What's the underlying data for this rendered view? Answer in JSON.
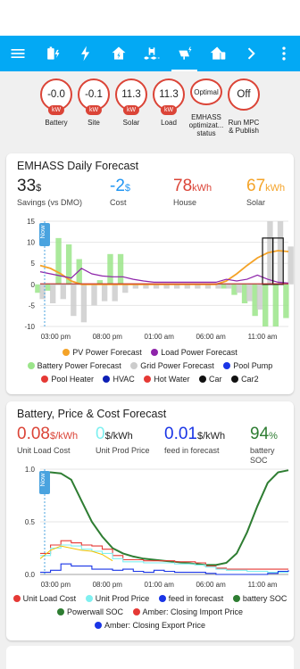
{
  "toolbar": {
    "tabs": [
      "menu-icon",
      "battery-charging-icon",
      "flash-icon",
      "home-lightning-icon",
      "pool-icon",
      "solar-power-icon",
      "home-battery-icon",
      "chevron-right-icon",
      "more-vert-icon"
    ]
  },
  "badges": [
    {
      "value": "-0.0",
      "unit": "kW",
      "label": "Battery"
    },
    {
      "value": "-0.1",
      "unit": "kW",
      "label": "Site"
    },
    {
      "value": "11.3",
      "unit": "kW",
      "label": "Solar"
    },
    {
      "value": "11.3",
      "unit": "kW",
      "label": "Load"
    },
    {
      "value": "Optimal",
      "unit": "",
      "label": "EMHASS optimizat... status"
    },
    {
      "value": "Off",
      "unit": "",
      "label": "Run MPC & Publish"
    }
  ],
  "forecast_card": {
    "title": "EMHASS Daily Forecast",
    "stats": [
      {
        "value": "33",
        "unit": "$",
        "name": "Savings (vs DMO)",
        "color": "#212121"
      },
      {
        "value": "-2",
        "unit": "$",
        "name": "Cost",
        "color": "#2196f3"
      },
      {
        "value": "78",
        "unit": "kWh",
        "name": "House",
        "color": "#db4437"
      },
      {
        "value": "67",
        "unit": "kWh",
        "name": "Solar",
        "color": "#f4a328"
      }
    ],
    "now_label": "Now",
    "legend": [
      {
        "label": "PV Power Forecast",
        "color": "#f4a328"
      },
      {
        "label": "Load Power Forecast",
        "color": "#8e24aa"
      },
      {
        "label": "Battery Power Forecast",
        "color": "#9be58a"
      },
      {
        "label": "Grid Power Forecast",
        "color": "#cccccc"
      },
      {
        "label": "Pool Pump",
        "color": "#1a35e6"
      },
      {
        "label": "Pool Heater",
        "color": "#e53935"
      },
      {
        "label": "HVAC",
        "color": "#0d1fb5"
      },
      {
        "label": "Hot Water",
        "color": "#e53935"
      },
      {
        "label": "Car",
        "color": "#111111"
      },
      {
        "label": "Car2",
        "color": "#111111"
      }
    ]
  },
  "price_card": {
    "title": "Battery, Price & Cost Forecast",
    "stats": [
      {
        "value": "0.08",
        "unit": "$/kWh",
        "name": "Unit Load Cost",
        "color": "#db4437"
      },
      {
        "value": "0",
        "unit": "$/kWh",
        "name": "Unit Prod Price",
        "color": "#7ff0f0"
      },
      {
        "value": "0.01",
        "unit": "$/kWh",
        "name": "feed in forecast",
        "color": "#1a35e6"
      },
      {
        "value": "94",
        "unit": "%",
        "name": "battery SOC",
        "color": "#2e7d32"
      }
    ],
    "now_label": "Now",
    "legend": [
      {
        "label": "Unit Load Cost",
        "color": "#e53935"
      },
      {
        "label": "Unit Prod Price",
        "color": "#7ff0f0"
      },
      {
        "label": "feed in forecast",
        "color": "#1a35e6"
      },
      {
        "label": "battery SOC",
        "color": "#2e7d32"
      },
      {
        "label": "Powerwall SOC",
        "color": "#2e7d32"
      },
      {
        "label": "Amber: Closing Import Price",
        "color": "#e53935"
      },
      {
        "label": "Amber: Closing Export Price",
        "color": "#1a35e6"
      }
    ]
  },
  "chart_data": [
    {
      "type": "area",
      "ylim": [
        -10,
        15
      ],
      "yticks": [
        "15",
        "10",
        "5",
        "0",
        "-5",
        "-10"
      ],
      "xticks": [
        "03:00 pm",
        "08:00 pm",
        "01:00 am",
        "06:00 am",
        "11:00 am"
      ],
      "series": [
        {
          "name": "PV Power Forecast",
          "x": [
            0,
            1,
            2,
            3,
            4,
            5,
            6,
            7,
            8,
            9,
            10,
            11,
            12,
            13,
            14,
            15,
            16,
            17,
            18,
            19,
            20,
            21,
            22,
            23,
            24
          ],
          "values": [
            4.5,
            3.8,
            2.5,
            0.8,
            0,
            0,
            0,
            0,
            0,
            0,
            0,
            0,
            0,
            0,
            0,
            0,
            0,
            0,
            0.8,
            2.5,
            4.5,
            6.3,
            7.5,
            8,
            7.8
          ]
        },
        {
          "name": "Battery Power Forecast",
          "x": [
            0,
            1,
            2,
            3,
            4,
            5,
            6,
            7,
            8,
            9,
            10,
            11,
            12,
            13,
            14,
            15,
            16,
            17,
            18,
            19,
            20,
            21,
            22,
            23,
            24
          ],
          "values": [
            -2,
            -1.5,
            11,
            9.5,
            6,
            0,
            1,
            7.2,
            7.2,
            0,
            0,
            0,
            0,
            0,
            0,
            0,
            0,
            0,
            -1,
            -2.5,
            -4.5,
            -7.5,
            -10,
            -10,
            -8
          ]
        },
        {
          "name": "Grid Power Forecast",
          "x": [
            0,
            1,
            2,
            3,
            4,
            5,
            6,
            7,
            8,
            9,
            10,
            11,
            12,
            13,
            14,
            15,
            16,
            17,
            18,
            19,
            20,
            21,
            22,
            23,
            24
          ],
          "values": [
            -3.5,
            -4.5,
            -3.5,
            -7.5,
            -9,
            -5,
            -4,
            -4,
            -2,
            -1,
            -1,
            -1,
            -1,
            -1,
            -1,
            -1,
            -1,
            -1,
            -1,
            -2,
            -4,
            -6,
            15,
            15,
            9
          ]
        },
        {
          "name": "Load Power Forecast",
          "x": [
            0,
            1,
            2,
            3,
            4,
            5,
            6,
            7,
            8,
            9,
            10,
            11,
            12,
            13,
            14,
            15,
            16,
            17,
            18,
            19,
            20,
            21,
            22,
            23,
            24
          ],
          "values": [
            3,
            2.5,
            2,
            1.5,
            3.8,
            2.5,
            2,
            1.8,
            1.8,
            1.2,
            0.8,
            0.5,
            0.5,
            0.5,
            0.5,
            0.5,
            0.5,
            0.5,
            1.2,
            0.8,
            1.2,
            2.2,
            1.2,
            0.5,
            0.3
          ]
        },
        {
          "name": "Car",
          "x": [
            0,
            1,
            2,
            3,
            4,
            5,
            6,
            7,
            8,
            9,
            10,
            11,
            12,
            13,
            14,
            15,
            16,
            17,
            18,
            19,
            20,
            21,
            22,
            23,
            24
          ],
          "values": [
            0,
            0,
            0,
            0,
            0,
            0,
            0,
            0,
            0,
            0,
            0,
            0,
            0,
            0,
            0,
            0,
            0,
            0,
            0,
            0,
            0,
            0,
            11,
            11,
            0
          ]
        }
      ]
    },
    {
      "type": "line",
      "ylim": [
        0,
        1.0
      ],
      "yticks": [
        "1.0",
        "0.5",
        "0.0"
      ],
      "xticks": [
        "03:00 pm",
        "08:00 pm",
        "01:00 am",
        "06:00 am",
        "11:00 am"
      ],
      "series": [
        {
          "name": "battery SOC",
          "x": [
            0,
            1,
            2,
            3,
            4,
            5,
            6,
            7,
            8,
            9,
            10,
            11,
            12,
            13,
            14,
            15,
            16,
            17,
            18,
            19,
            20,
            21,
            22,
            23,
            24
          ],
          "values": [
            0.97,
            0.97,
            0.96,
            0.9,
            0.7,
            0.5,
            0.36,
            0.25,
            0.2,
            0.17,
            0.15,
            0.14,
            0.13,
            0.12,
            0.11,
            0.1,
            0.09,
            0.09,
            0.11,
            0.2,
            0.4,
            0.65,
            0.87,
            0.97,
            0.99
          ]
        },
        {
          "name": "Unit Load Cost",
          "x": [
            0,
            1,
            2,
            3,
            4,
            5,
            6,
            7,
            8,
            9,
            10,
            11,
            12,
            13,
            14,
            15,
            16,
            17,
            18,
            19,
            20,
            21,
            22,
            23,
            24
          ],
          "values": [
            0.2,
            0.28,
            0.32,
            0.3,
            0.28,
            0.27,
            0.24,
            0.18,
            0.14,
            0.14,
            0.13,
            0.13,
            0.13,
            0.12,
            0.12,
            0.11,
            0.08,
            0.06,
            0.05,
            0.05,
            0.05,
            0.05,
            0.05,
            0.05,
            0.05
          ]
        },
        {
          "name": "Unit Prod Price",
          "x": [
            0,
            1,
            2,
            3,
            4,
            5,
            6,
            7,
            8,
            9,
            10,
            11,
            12,
            13,
            14,
            15,
            16,
            17,
            18,
            19,
            20,
            21,
            22,
            23,
            24
          ],
          "values": [
            0.18,
            0.25,
            0.28,
            0.27,
            0.24,
            0.22,
            0.2,
            0.15,
            0.12,
            0.12,
            0.11,
            0.11,
            0.11,
            0.1,
            0.1,
            0.09,
            0.07,
            0.05,
            0.04,
            0.04,
            0.03,
            0.03,
            0.02,
            0.02,
            0.02
          ]
        },
        {
          "name": "feed in forecast",
          "x": [
            0,
            1,
            2,
            3,
            4,
            5,
            6,
            7,
            8,
            9,
            10,
            11,
            12,
            13,
            14,
            15,
            16,
            17,
            18,
            19,
            20,
            21,
            22,
            23,
            24
          ],
          "values": [
            0.02,
            0.04,
            0.1,
            0.08,
            0.08,
            0.05,
            0.05,
            0.04,
            0.05,
            0.03,
            0.02,
            0.04,
            0.03,
            0.02,
            0.02,
            0.02,
            0.01,
            0.0,
            0.0,
            0.0,
            0.0,
            0.0,
            0.01,
            0.03,
            0.04
          ]
        }
      ]
    }
  ]
}
